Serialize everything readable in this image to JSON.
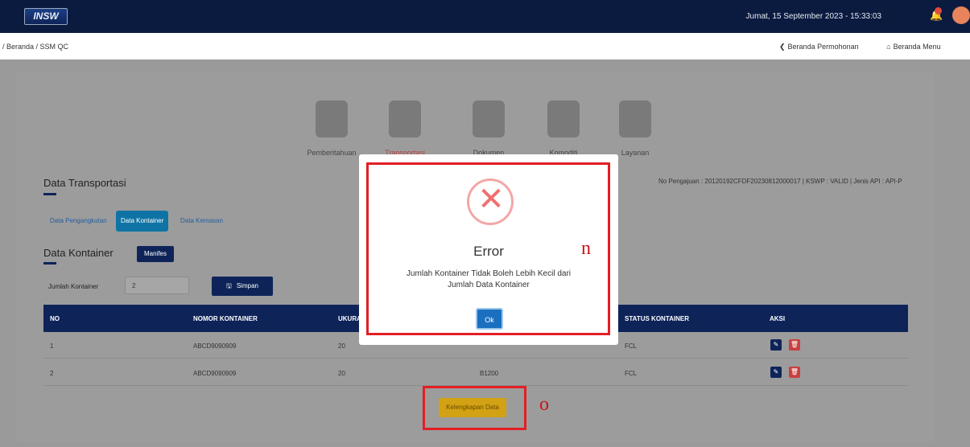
{
  "header": {
    "logo_text": "INSW",
    "datetime": "Jumat, 15 September 2023 - 15:33:03",
    "colors": {
      "navbar": "#0b1b40",
      "accent": "#0f74a5",
      "warning": "#d2a114",
      "danger": "#e31e24"
    }
  },
  "breadcrumb": {
    "path": "/ Beranda / SSM QC",
    "back_link": "Beranda Permohonan",
    "home_link": "Beranda Menu"
  },
  "steps": [
    {
      "label": "Pemberitahuan",
      "icon": "building-icon"
    },
    {
      "label": "Transportasi",
      "icon": "plane-globe-icon",
      "active": true
    },
    {
      "label": "Dokumen",
      "icon": "document-icon"
    },
    {
      "label": "Komoditi",
      "icon": "boxes-icon"
    },
    {
      "label": "Layanan",
      "icon": "support-agent-icon"
    }
  ],
  "section": {
    "title": "Data Transportasi",
    "info": "No Pengajuan : 20120192CFDF20230812000017 | KSWP : VALID | Jenis API : API-P",
    "tabs": [
      "Data Pengangkutan",
      "Data Kontainer",
      "Data Kemasan"
    ],
    "active_tab": "Data Kontainer"
  },
  "kontainer": {
    "title": "Data Kontainer",
    "manifes_label": "Manifes",
    "jumlah_label": "Jumlah Kontainer",
    "jumlah_value": "2",
    "simpan_label": "Simpan"
  },
  "table": {
    "headers": [
      "NO",
      "NOMOR KONTAINER",
      "UKURAN",
      "",
      "STATUS KONTAINER",
      "AKSI"
    ],
    "rows": [
      {
        "no": "1",
        "nomor": "ABCD9090909",
        "ukuran": "20",
        "tipe": "",
        "status": "FCL"
      },
      {
        "no": "2",
        "nomor": "ABCD9090909",
        "ukuran": "20",
        "tipe": "B1200",
        "status": "FCL"
      }
    ]
  },
  "kelengkapan_label": "Kelengkapan Data",
  "modal": {
    "title": "Error",
    "message_line1": "Jumlah Kontainer Tidak Boleh Lebih Kecil dari",
    "message_line2": "Jumlah Data Kontainer",
    "ok_label": "Ok"
  },
  "annotations": {
    "n": "n",
    "o": "o"
  }
}
